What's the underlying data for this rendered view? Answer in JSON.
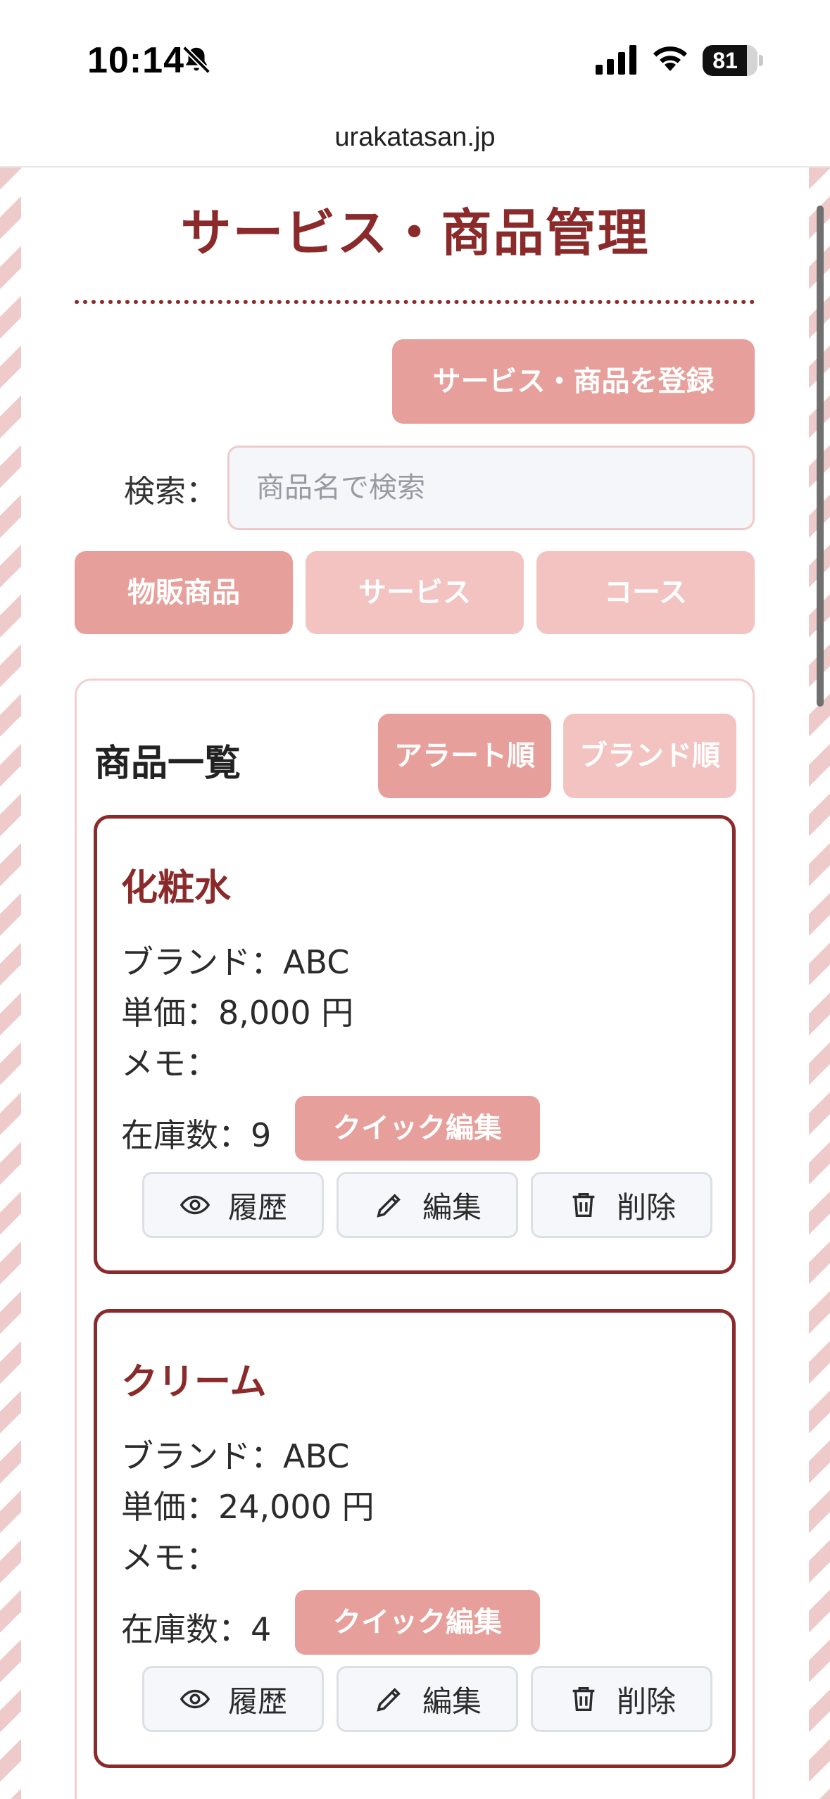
{
  "status_bar": {
    "time": "10:14",
    "battery": "81",
    "battery_level": 0.81
  },
  "browser": {
    "url": "urakatasan.jp"
  },
  "page": {
    "title": "サービス・商品管理",
    "register_button": "サービス・商品を登録",
    "search": {
      "label": "検索：",
      "placeholder": "商品名で検索",
      "value": ""
    },
    "category_tabs": [
      {
        "label": "物販商品",
        "active": true
      },
      {
        "label": "サービス",
        "active": false
      },
      {
        "label": "コース",
        "active": false
      }
    ],
    "list": {
      "title": "商品一覧",
      "sort_buttons": [
        {
          "label": "アラート順",
          "active": true
        },
        {
          "label": "ブランド順",
          "active": false
        }
      ],
      "products": [
        {
          "name": "化粧水",
          "brand": "ブランド：ABC",
          "price": "単価：8,000 円",
          "memo": "メモ：",
          "stock": "在庫数：9",
          "quick_edit": "クイック編集",
          "history": "履歴",
          "edit": "編集",
          "delete": "削除"
        },
        {
          "name": "クリーム",
          "brand": "ブランド：ABC",
          "price": "単価：24,000 円",
          "memo": "メモ：",
          "stock": "在庫数：4",
          "quick_edit": "クイック編集",
          "history": "履歴",
          "edit": "編集",
          "delete": "削除"
        }
      ]
    }
  },
  "colors": {
    "accent_dark": "#8b2a2a",
    "accent": "#e69f9a",
    "accent_light": "#f2c3c0"
  },
  "icons": [
    "bell-slash-icon",
    "cellular-signal-icon",
    "wifi-icon",
    "battery-icon",
    "eye-icon",
    "pencil-icon",
    "trash-icon"
  ]
}
